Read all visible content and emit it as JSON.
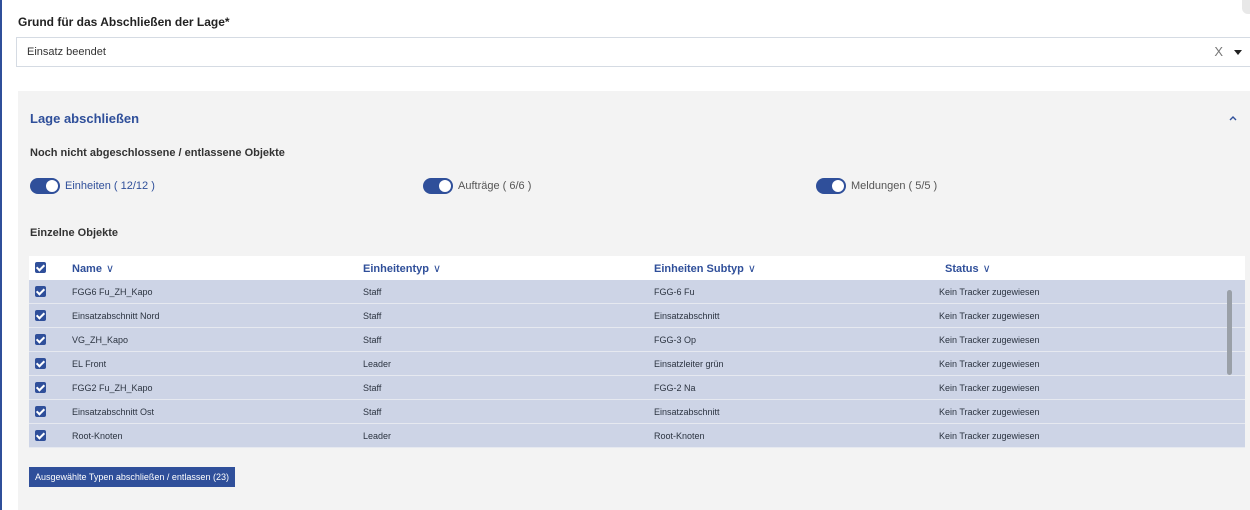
{
  "reason": {
    "label": "Grund für das Abschließen der Lage*",
    "value": "Einsatz beendet",
    "clear_glyph": "X"
  },
  "panel": {
    "title": "Lage abschließen",
    "subtitle": "Noch nicht abgeschlossene / entlassene Objekte",
    "toggles": [
      {
        "label": "Einheiten ( 12/12 )",
        "on": true
      },
      {
        "label": "Aufträge ( 6/6 )",
        "on": true
      },
      {
        "label": "Meldungen ( 5/5 )",
        "on": true
      }
    ],
    "objects_title": "Einzelne Objekte"
  },
  "table": {
    "columns": [
      "Name",
      "Einheitentyp",
      "Einheiten Subtyp",
      "Status"
    ],
    "rows": [
      {
        "name": "FGG6 Fu_ZH_Kapo",
        "type": "Staff",
        "subtype": "FGG-6 Fu",
        "status": "Kein Tracker zugewiesen"
      },
      {
        "name": "Einsatzabschnitt Nord",
        "type": "Staff",
        "subtype": "Einsatzabschnitt",
        "status": "Kein Tracker zugewiesen"
      },
      {
        "name": "VG_ZH_Kapo",
        "type": "Staff",
        "subtype": "FGG-3 Op",
        "status": "Kein Tracker zugewiesen"
      },
      {
        "name": "EL Front",
        "type": "Leader",
        "subtype": "Einsatzleiter grün",
        "status": "Kein Tracker zugewiesen"
      },
      {
        "name": "FGG2 Fu_ZH_Kapo",
        "type": "Staff",
        "subtype": "FGG-2 Na",
        "status": "Kein Tracker zugewiesen"
      },
      {
        "name": "Einsatzabschnitt Ost",
        "type": "Staff",
        "subtype": "Einsatzabschnitt",
        "status": "Kein Tracker zugewiesen"
      },
      {
        "name": "Root-Knoten",
        "type": "Leader",
        "subtype": "Root-Knoten",
        "status": "Kein Tracker zugewiesen"
      }
    ]
  },
  "submit_label": "Ausgewählte Typen abschließen / entlassen (23)",
  "colors": {
    "accent": "#2f4f9a",
    "row_selected": "#cdd4e6",
    "panel_bg": "#f3f3f3"
  }
}
